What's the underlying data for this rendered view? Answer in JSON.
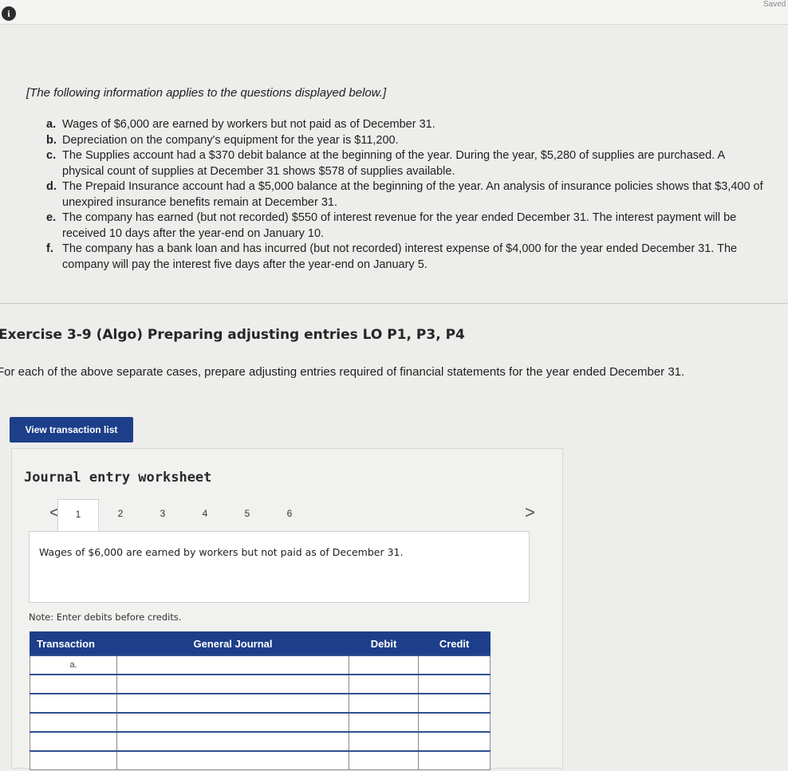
{
  "header": {
    "saved_label": "Saved",
    "info_icon": "info-icon"
  },
  "intro": "[The following information applies to the questions displayed below.]",
  "cases": [
    {
      "marker": "a.",
      "text": "Wages of $6,000 are earned by workers but not paid as of December 31."
    },
    {
      "marker": "b.",
      "text": "Depreciation on the company's equipment for the year is $11,200."
    },
    {
      "marker": "c.",
      "text": "The Supplies account had a $370 debit balance at the beginning of the year. During the year, $5,280 of supplies are purchased. A physical count of supplies at December 31 shows $578 of supplies available."
    },
    {
      "marker": "d.",
      "text": "The Prepaid Insurance account had a $5,000 balance at the beginning of the year. An analysis of insurance policies shows that $3,400 of unexpired insurance benefits remain at December 31."
    },
    {
      "marker": "e.",
      "text": "The company has earned (but not recorded) $550 of interest revenue for the year ended December 31. The interest payment will be received 10 days after the year-end on January 10."
    },
    {
      "marker": "f.",
      "text": "The company has a bank loan and has incurred (but not recorded) interest expense of $4,000 for the year ended December 31. The company will pay the interest five days after the year-end on January 5."
    }
  ],
  "exercise": {
    "title": "Exercise 3-9 (Algo) Preparing adjusting entries LO P1, P3, P4",
    "instructions": "For each of the above separate cases, prepare adjusting entries required of financial statements for the year ended December 31."
  },
  "buttons": {
    "view_transaction_list": "View transaction list"
  },
  "worksheet": {
    "title": "Journal entry worksheet",
    "tabs": [
      "1",
      "2",
      "3",
      "4",
      "5",
      "6"
    ],
    "active_tab": "1",
    "prev_arrow": "<",
    "next_arrow": ">",
    "description": "Wages of $6,000 are earned by workers but not paid as of December 31.",
    "note": "Note: Enter debits before credits.",
    "table": {
      "headers": [
        "Transaction",
        "General Journal",
        "Debit",
        "Credit"
      ],
      "rows": [
        {
          "transaction": "a.",
          "account": "",
          "debit": "",
          "credit": ""
        },
        {
          "transaction": "",
          "account": "",
          "debit": "",
          "credit": ""
        },
        {
          "transaction": "",
          "account": "",
          "debit": "",
          "credit": ""
        },
        {
          "transaction": "",
          "account": "",
          "debit": "",
          "credit": ""
        },
        {
          "transaction": "",
          "account": "",
          "debit": "",
          "credit": ""
        },
        {
          "transaction": "",
          "account": "",
          "debit": "",
          "credit": ""
        }
      ]
    }
  }
}
